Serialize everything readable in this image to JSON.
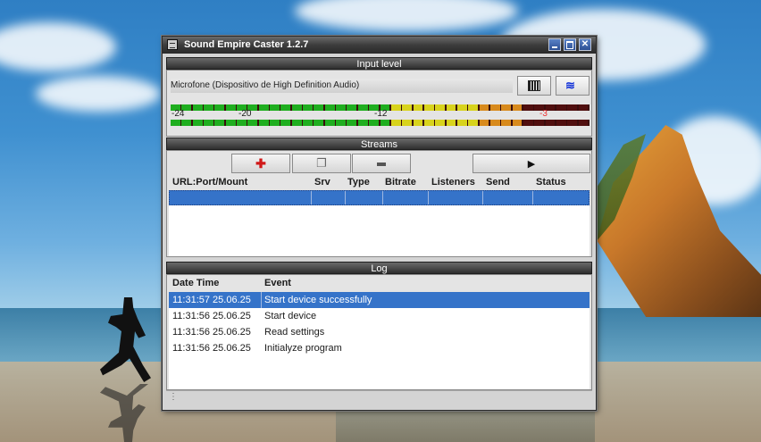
{
  "window": {
    "title": "Sound Empire Caster 1.2.7",
    "controls": [
      "minimize",
      "maximize",
      "close"
    ]
  },
  "input_level": {
    "header": "Input level",
    "device": "Microfone (Dispositivo de High Definition Audio)",
    "meter_labels": [
      "-24",
      "-20",
      "-12",
      "-3"
    ],
    "level_top": 0.84,
    "level_bottom": 0.84
  },
  "streams": {
    "header": "Streams",
    "toolbar": [
      "add-icon",
      "copy-icon",
      "remove-icon",
      "play-icon"
    ],
    "columns": [
      "URL:Port/Mount",
      "Srv",
      "Type",
      "Bitrate",
      "Listeners",
      "Send",
      "Status"
    ]
  },
  "log": {
    "header": "Log",
    "columns": [
      "Date Time",
      "Event"
    ],
    "rows": [
      {
        "datetime": "11:31:57 25.06.25",
        "event": "Start device successfully"
      },
      {
        "datetime": "11:31:56 25.06.25",
        "event": "Start device"
      },
      {
        "datetime": "11:31:56 25.06.25",
        "event": "Read settings"
      },
      {
        "datetime": "11:31:56 25.06.25",
        "event": "Initialyze program"
      }
    ]
  },
  "colors": {
    "selection": "#3573c9",
    "meter_green": "#1fae1f",
    "meter_yellow": "#d8d31c",
    "meter_orange": "#d88a1c",
    "meter_red": "#7a1313"
  }
}
